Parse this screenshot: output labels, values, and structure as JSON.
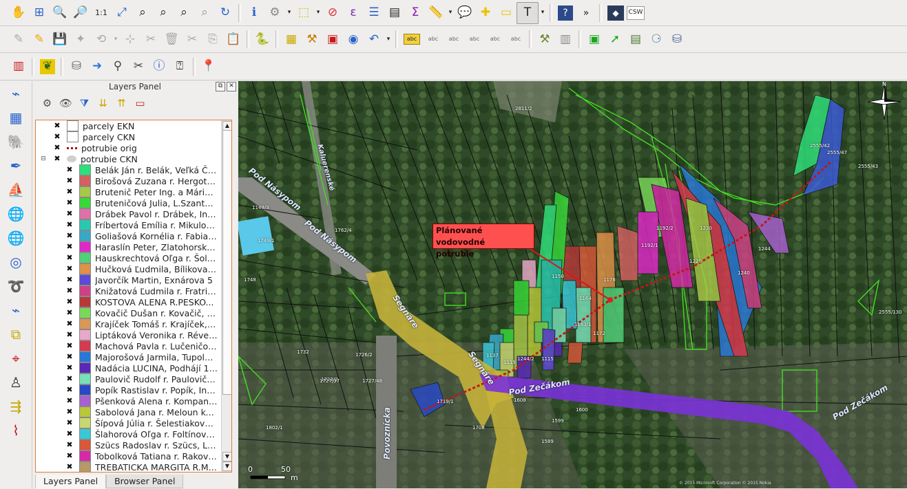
{
  "toolbar_row1": {
    "icons": [
      "pan-icon",
      "pan-to-selection-icon",
      "zoom-in-icon",
      "zoom-out-icon",
      "zoom-actual-size-icon",
      "zoom-full-icon",
      "zoom-to-selection-icon",
      "zoom-to-layer-icon",
      "zoom-last-icon",
      "zoom-next-icon",
      "refresh-icon",
      "identify-icon",
      "run-action-icon",
      "select-features-icon",
      "deselect-icon",
      "select-by-expression-icon",
      "attribute-table-icon",
      "statistics-icon",
      "field-calculator-icon",
      "measure-icon",
      "map-tips-icon",
      "new-bookmark-icon",
      "show-bookmarks-icon",
      "text-annotation-icon",
      "help-icon",
      "more-icon",
      "metasearch-icon"
    ],
    "csw_label": "CSW"
  },
  "toolbar_row2": {
    "icons": [
      "edit-pencil-disabled-icon",
      "toggle-editing-icon",
      "save-edits-icon",
      "add-feature-icon",
      "move-feature-icon",
      "node-tool-icon",
      "delete-selected-icon",
      "cut-features-icon",
      "copy-features-icon",
      "paste-features-icon",
      "python-console-icon",
      "layer-grid-icon",
      "digitize-tool-icon",
      "composer-icon",
      "plugin-icon",
      "undo-icon",
      "label-icon",
      "label-pin-icon",
      "label-show-icon",
      "label-move-icon",
      "label-rotate-icon",
      "label-change-icon",
      "grass-tools-icon",
      "db-manager-icon",
      "vector-digitize-icon",
      "raster-icon",
      "network-icon",
      "database-icon"
    ],
    "label_text": "abc"
  },
  "toolbar_row3": {
    "icons": [
      "layer-style-icon",
      "plugin-leaf-icon",
      "database-stack-icon",
      "arrow-right-icon",
      "search-icon",
      "scissors-icon",
      "help-circle-icon",
      "whats-this-icon",
      "geotag-marker-icon"
    ]
  },
  "left_toolbar": {
    "icons": [
      "add-vector-layer-icon",
      "add-raster-layer-icon",
      "add-postgis-layer-icon",
      "add-spatialite-layer-icon",
      "add-wms-layer-icon",
      "add-wcs-layer-icon",
      "add-wfs-layer-icon",
      "add-delimited-text-icon",
      "add-oracle-layer-icon",
      "new-shapefile-layer-icon",
      "add-virtual-layer-icon",
      "georeferencer-icon",
      "coordinate-capture-icon",
      "gps-tools-icon",
      "spatial-query-icon"
    ]
  },
  "layers_panel": {
    "title": "Layers Panel",
    "float_button": "⧉",
    "close_button": "✕",
    "layers": [
      {
        "name": "parcely EKN",
        "swatch": "#ffffff",
        "type": "group-layer"
      },
      {
        "name": "parcely CKN",
        "swatch": "#ffffff",
        "type": "group-layer"
      },
      {
        "name": "potrubie orig",
        "swatch": "#b01010",
        "type": "line"
      },
      {
        "name": "potrubie CKN",
        "swatch": "#d0d0d0",
        "type": "expanded"
      }
    ],
    "categories": [
      {
        "name": "Belák Ján r. Belák, Veľká Ča...",
        "color": "#2ee07a"
      },
      {
        "name": "Birošová Zuzana r. Hergott...",
        "color": "#d46060"
      },
      {
        "name": "Brutenič Peter Ing. a Mária,...",
        "color": "#a8c848"
      },
      {
        "name": "Bruteničová Julia, L.Szantо...",
        "color": "#38d838"
      },
      {
        "name": "Drábek Pavol r. Drábek, Ing....",
        "color": "#e070a8"
      },
      {
        "name": "Fríbertová Emília r. Mikulov...",
        "color": "#28c8b0"
      },
      {
        "name": "Goliašová Kornélia r. Fabian...",
        "color": "#38a8c8"
      },
      {
        "name": "Haraslín Peter, Zlatohorská 15",
        "color": "#e028c8"
      },
      {
        "name": "Hauskrechtová Oľga r. Šolté...",
        "color": "#50d078"
      },
      {
        "name": "Hučková Ľudmila, Bílikova 7...",
        "color": "#e09048"
      },
      {
        "name": "Javorčík Martin, Exnárova 5",
        "color": "#6048d8"
      },
      {
        "name": "Knižatová Ľudmila r. Fratrič...",
        "color": "#d04088"
      },
      {
        "name": "KOSTOVA ALENA R.PESKO...",
        "color": "#b83838"
      },
      {
        "name": "Kovačič Dušan r. Kovačič, P...",
        "color": "#78d858"
      },
      {
        "name": "Krajíček Tomáš r. Krajíček, J...",
        "color": "#d89858"
      },
      {
        "name": "Liptáková Veronika r. Réves...",
        "color": "#e8a8c8"
      },
      {
        "name": "Machová Pavla r. Lučeničov...",
        "color": "#d83850"
      },
      {
        "name": "Majorošová Jarmila, Tupole...",
        "color": "#2878d8"
      },
      {
        "name": "Nadácia LUCINA, Podhájí 1/c...",
        "color": "#5828b8"
      },
      {
        "name": "Paulovič Rudolf r. Paulovič ...",
        "color": "#78e0b8"
      },
      {
        "name": "Popík Rastislav r. Popík, Ing....",
        "color": "#2848c8"
      },
      {
        "name": "Pšenková Alena r. Kompaní...",
        "color": "#a860d0"
      },
      {
        "name": "Sabolová Jana r. Meloun kov...",
        "color": "#b8c838"
      },
      {
        "name": "Šípová Júlia r. Šelestiaková, ...",
        "color": "#c8d870"
      },
      {
        "name": "Šlahorová Oľga r. Foltínová,...",
        "color": "#38c8d8"
      },
      {
        "name": "Szücs Radoslav r. Szücs, Lau...",
        "color": "#d85838"
      },
      {
        "name": "Tobolková Tatiana r. Rakovi...",
        "color": "#d828a8"
      },
      {
        "name": "TREBATICKA MARGITA R.MI...",
        "color": "#b89868"
      }
    ],
    "tabs": [
      "Layers Panel",
      "Browser Panel"
    ]
  },
  "map": {
    "annotation": [
      "Plánované vodovodné",
      "potrubie"
    ],
    "roads": [
      "Pod Násypom",
      "Pod Násypom",
      "Segnáre",
      "Segnáre",
      "Pod Zečákom",
      "Pod Zečákom",
      "Povoznícka",
      "Kaluerenské"
    ],
    "scale": {
      "zero": "0",
      "value": "50",
      "unit": "m"
    },
    "parcel_numbers": [
      "2811/2",
      "1749/1",
      "1748",
      "1762/4",
      "1732",
      "1726/2",
      "1727/2",
      "1727/37",
      "1727/48",
      "1230",
      "1220",
      "1240",
      "1244",
      "1192/1",
      "1192/2",
      "1178",
      "1164",
      "1163/1",
      "1172",
      "1150",
      "1137",
      "1244/2",
      "1115",
      "1119",
      "1608",
      "1600",
      "1589",
      "1599",
      "2555/42",
      "2555/47",
      "2555/43",
      "2555/130",
      "1149/3",
      "1719/1",
      "1708",
      "1802/1"
    ],
    "attribution": "© 2015 Microsoft Corporation  © 2015 Nokia"
  },
  "colors": {
    "road_yellow": "#c8b43a",
    "road_purple": "#7a32d8",
    "pipe_red": "#c01818",
    "parcel_line": "#111111",
    "ekn_green": "#44dd22",
    "selection_orange": "#e07a3c"
  }
}
